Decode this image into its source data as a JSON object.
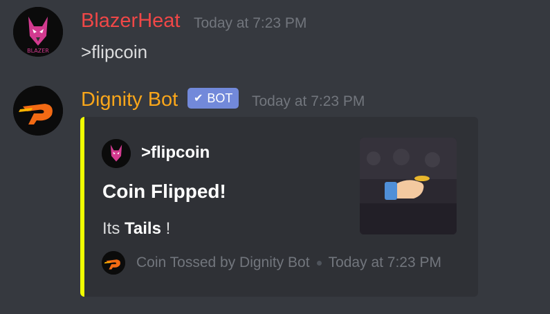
{
  "colors": {
    "background": "#36393f",
    "user_name": "#f04747",
    "bot_name": "#faa61a",
    "bot_tag": "#7289da",
    "embed_accent": "#f0ff00"
  },
  "messages": [
    {
      "author": "BlazerHeat",
      "timestamp": "Today at 7:23 PM",
      "content": ">flipcoin",
      "avatar_text": "BLAZER"
    },
    {
      "author": "Dignity Bot",
      "bot_tag": "BOT",
      "timestamp": "Today at 7:23 PM",
      "embed": {
        "author_name": ">flipcoin",
        "title": "Coin Flipped!",
        "description_prefix": "Its",
        "description_bold": "Tails",
        "description_suffix": "!",
        "footer_text": "Coin Tossed by Dignity Bot",
        "footer_timestamp": "Today at 7:23 PM"
      }
    }
  ]
}
